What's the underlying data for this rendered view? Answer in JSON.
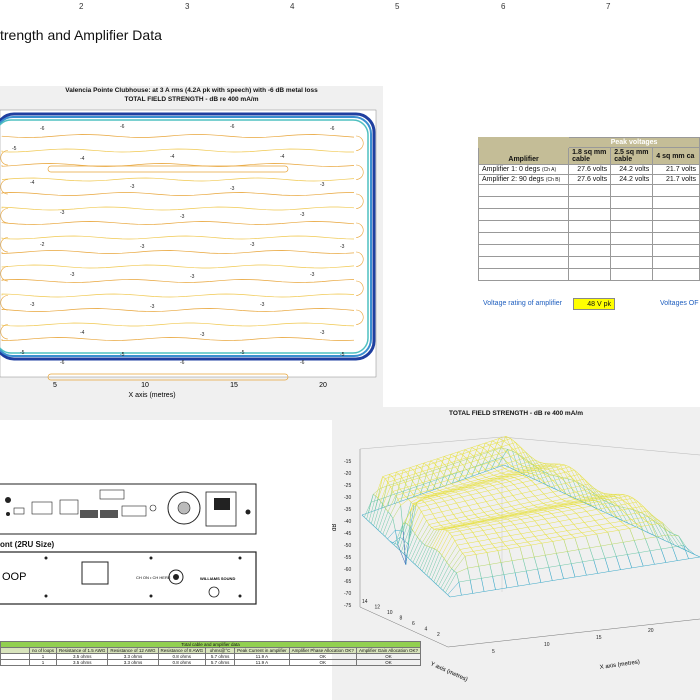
{
  "ruler": {
    "ticks": [
      "2",
      "3",
      "4",
      "5",
      "6",
      "7"
    ]
  },
  "section_title": "trength and Amplifier Data",
  "contour_plot": {
    "title_line1": "Valencia Pointe Clubhouse: at 3 A rms (4.2A pk with speech) with -6 dB metal loss",
    "title_line2": "TOTAL FIELD STRENGTH - dB re 400 mA/m",
    "xlabel": "X axis (metres)",
    "x_ticks": [
      "5",
      "10",
      "15",
      "20"
    ],
    "contour_labels": [
      "-6",
      "-5",
      "-4",
      "-3",
      "-2"
    ]
  },
  "peak_table": {
    "header_group": "Peak voltages",
    "col_amplifier": "Amplifier",
    "col_18": "1.8 sq mm cable",
    "col_25": "2.5 sq mm cable",
    "col_4": "4 sq mm ca",
    "rows": [
      {
        "name": "Amplifier 1:",
        "phase": "0 degs",
        "ch": "(Ch A)",
        "v18": "27.6 volts",
        "v25": "24.2 volts",
        "v4": "21.7 volts"
      },
      {
        "name": "Amplifier 2:",
        "phase": "90 degs",
        "ch": "(Ch B)",
        "v18": "27.6 volts",
        "v25": "24.2 volts",
        "v4": "21.7 volts"
      }
    ],
    "rating_label": "Voltage rating of amplifier",
    "rating_value": "48 V pk",
    "ohms_label": "Voltages OF"
  },
  "device": {
    "front_title": "ont (2RU Size)",
    "front_text": "OOP",
    "brand": "WILLIAMS SOUND",
    "model": "CH ON • CH HERE"
  },
  "surface_plot": {
    "title": "TOTAL FIELD STRENGTH - dB re 400 mA/m",
    "zlabel": "dB",
    "z_ticks": [
      "-15",
      "-20",
      "-25",
      "-30",
      "-35",
      "-40",
      "-45",
      "-50",
      "-55",
      "-60",
      "-65",
      "-70",
      "-75"
    ],
    "ylabel": "Y axis (metres)",
    "xlabel": "X axis (metres)",
    "y_ticks": [
      "14",
      "12",
      "10",
      "8",
      "6",
      "4",
      "2"
    ],
    "x_ticks": [
      "5",
      "10",
      "15",
      "20"
    ]
  },
  "cable_table": {
    "title": "Total cable and amplifier data",
    "headers": [
      "no of loops",
      "Resistance of 1.5 AWG",
      "Resistance of 12 AWG",
      "Resistance of 8 AWG",
      "ohms@°C",
      "Peak Current in amplifier",
      "Amplifier Phase Allocation OK?",
      "Amplifier Gain Allocation OK?"
    ],
    "rows": [
      [
        "1",
        "3.5 ohms",
        "3.3 ohms",
        "0.8 ohms",
        "5.7 ohms",
        "11.9 A",
        "OK",
        "OK"
      ],
      [
        "1",
        "3.5 ohms",
        "3.3 ohms",
        "0.8 ohms",
        "5.7 ohms",
        "11.9 A",
        "OK",
        "OK"
      ]
    ]
  }
}
